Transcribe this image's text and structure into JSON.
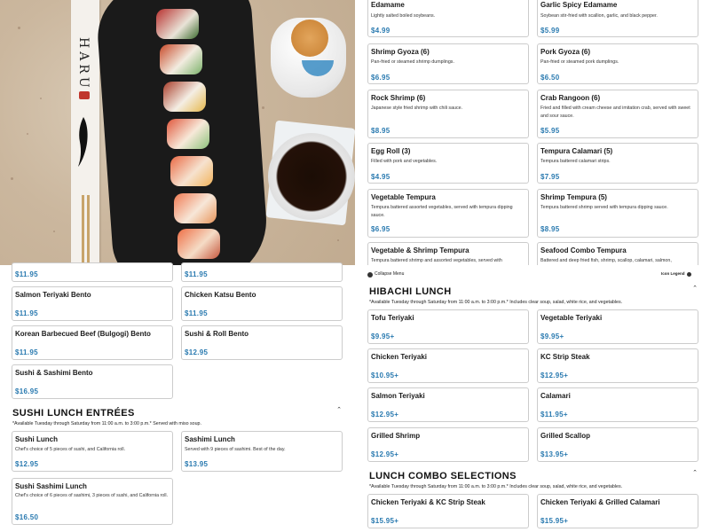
{
  "left": {
    "bento_prices_top": [
      "$11.95",
      "$11.95"
    ],
    "bento_items": [
      {
        "name": "Salmon Teriyaki Bento",
        "price": "$11.95"
      },
      {
        "name": "Chicken Katsu Bento",
        "price": "$11.95"
      },
      {
        "name": "Korean Barbecued Beef (Bulgogi) Bento",
        "price": "$11.95"
      },
      {
        "name": "Sushi & Roll Bento",
        "price": "$12.95"
      },
      {
        "name": "Sushi & Sashimi Bento",
        "price": "$16.95"
      }
    ],
    "sushi_lunch": {
      "title": "SUSHI LUNCH ENTRÉES",
      "note": "*Available Tuesday through Saturday from 11:00 a.m. to 3:00 p.m.* Served with miso soup.",
      "items": [
        {
          "name": "Sushi Lunch",
          "desc": "Chef's choice of 5 pieces of sushi, and California roll.",
          "price": "$12.95"
        },
        {
          "name": "Sashimi Lunch",
          "desc": "Served with 9 pieces of sashimi. Best of the day.",
          "price": "$13.95"
        },
        {
          "name": "Sushi Sashimi Lunch",
          "desc": "Chef's choice of 6 pieces of sashimi, 3 pieces of sushi, and California roll.",
          "price": "$16.50"
        }
      ]
    },
    "hero": {
      "napkin_brand": "HARU"
    }
  },
  "right": {
    "appetizers": [
      {
        "name": "Edamame",
        "desc": "Lightly salted boiled soybeans.",
        "price": "$4.99"
      },
      {
        "name": "Garlic Spicy Edamame",
        "desc": "Soybean stir-fried with scallion, garlic, and black pepper.",
        "price": "$5.99"
      },
      {
        "name": "Shrimp Gyoza (6)",
        "desc": "Pan-fried or steamed shrimp dumplings.",
        "price": "$6.95"
      },
      {
        "name": "Pork Gyoza (6)",
        "desc": "Pan-fried or steamed pork dumplings.",
        "price": "$6.50"
      },
      {
        "name": "Rock Shrimp (6)",
        "desc": "Japanese style fried shrimp with chili sauce.",
        "price": "$8.95"
      },
      {
        "name": "Crab Rangoon (6)",
        "desc": "Fried and filled with cream cheese and imitation crab, served with sweet and sour sauce.",
        "price": "$5.95"
      },
      {
        "name": "Egg Roll (3)",
        "desc": "Filled with pork and vegetables.",
        "price": "$4.95"
      },
      {
        "name": "Tempura Calamari (5)",
        "desc": "Tempura battered calamari strips.",
        "price": "$7.95"
      },
      {
        "name": "Vegetable Tempura",
        "desc": "Tempura battered assorted vegetables, served with tempura dipping sauce.",
        "price": "$6.95"
      },
      {
        "name": "Shrimp Tempura (5)",
        "desc": "Tempura battered shrimp served with tempura dipping sauce.",
        "price": "$8.95"
      },
      {
        "name": "Vegetable & Shrimp Tempura",
        "desc": "Tempura battered shrimp and assorted vegetables, served with",
        "price": ""
      },
      {
        "name": "Seafood Combo Tempura",
        "desc": "Battered and deep fried fish, shrimp, scallop, calamari, salmon,",
        "price": ""
      }
    ],
    "toolbar": {
      "collapse_label": "Collapse Menu",
      "legend_label": "Icon Legend"
    },
    "hibachi": {
      "title": "HIBACHI LUNCH",
      "note": "*Available Tuesday through Saturday from 11:00 a.m. to 3:00 p.m.* Includes clear soup, salad, white rice, and vegetables.",
      "items": [
        {
          "name": "Tofu Teriyaki",
          "price": "$9.95+"
        },
        {
          "name": "Vegetable Teriyaki",
          "price": "$9.95+"
        },
        {
          "name": "Chicken Teriyaki",
          "price": "$10.95+"
        },
        {
          "name": "KC Strip Steak",
          "price": "$12.95+"
        },
        {
          "name": "Salmon Teriyaki",
          "price": "$12.95+"
        },
        {
          "name": "Calamari",
          "price": "$11.95+"
        },
        {
          "name": "Grilled Shrimp",
          "price": "$12.95+"
        },
        {
          "name": "Grilled Scallop",
          "price": "$13.95+"
        }
      ]
    },
    "combo": {
      "title": "LUNCH COMBO SELECTIONS",
      "note": "*Available Tuesday through Saturday from 11:00 a.m. to 3:00 p.m.* Includes clear soup, salad, white rice, and vegetables.",
      "items": [
        {
          "name": "Chicken Teriyaki & KC Strip Steak",
          "price": "$15.95+"
        },
        {
          "name": "Chicken Teriyaki & Grilled Calamari",
          "price": "$15.95+"
        }
      ]
    }
  },
  "colors": {
    "price": "#2a7ab0",
    "border": "#cccccc"
  },
  "icons": [
    "chevron-up-icon",
    "collapse-icon",
    "legend-icon"
  ]
}
